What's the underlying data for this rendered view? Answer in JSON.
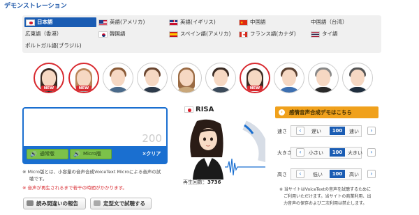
{
  "page_title": "デモンストレーション",
  "languages": [
    {
      "label": "日本語",
      "flag": "jp",
      "selected": true
    },
    {
      "label": "英語(アメリカ)",
      "flag": "us"
    },
    {
      "label": "英語(イギリス)",
      "flag": "gb"
    },
    {
      "label": "中国語",
      "flag": "cn"
    },
    {
      "label": "中国語（台湾）",
      "flag": ""
    },
    {
      "label": "広東語（香港）",
      "flag": ""
    },
    {
      "label": "韓国語",
      "flag": "kr"
    },
    {
      "label": "スペイン語(アメリカ)",
      "flag": "es"
    },
    {
      "label": "フランス語(カナダ)",
      "flag": "ca"
    },
    {
      "label": "タイ語",
      "flag": "th"
    },
    {
      "label": "ポルトガル語(ブラジル)",
      "flag": ""
    }
  ],
  "speaker_badge": "NEW",
  "editor": {
    "char_count": "200",
    "mode_normal": "通常版",
    "mode_micro": "Micro版",
    "clear": "×クリア"
  },
  "notes": {
    "micro_line1": "※ Micro版とは、小容量の音声合成VoiceText Microによる音声の試",
    "micro_line2": "聴です。",
    "delay": "※ 音声が再生されるまで若干の時間がかかります。"
  },
  "actions": {
    "report": "読み間違いの報告",
    "template": "定型文で試聴する"
  },
  "character": {
    "name": "RISA",
    "play_count_label": "再生回数：",
    "play_count": "3736"
  },
  "emotion_button": "感情音声合成デモはこちら",
  "params": [
    {
      "label": "速さ",
      "low": "遅い",
      "value": "100",
      "high": "速い"
    },
    {
      "label": "大きさ",
      "low": "小さい",
      "value": "100",
      "high": "大きい"
    },
    {
      "label": "高さ",
      "low": "低い",
      "value": "100",
      "high": "高い"
    }
  ],
  "disclaimer": [
    "※ 当サイトはVoiceTextの音声を試聴するために",
    "ご利用いただけます。当サイトの商業利用、出",
    "力音声の保存および二次利用は禁止します。"
  ]
}
